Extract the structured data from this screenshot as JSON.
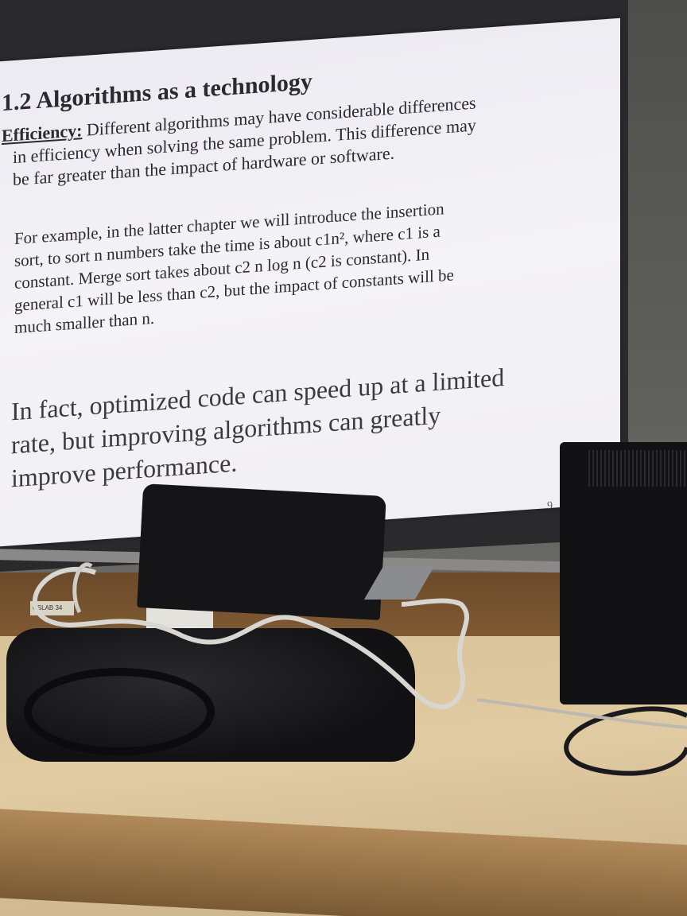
{
  "slide": {
    "title": "1.2 Algorithms as a technology",
    "paragraph1": {
      "label": "Efficiency:",
      "line1": " Different algorithms may have considerable differences",
      "line2": "in efficiency when solving the same problem. This difference may",
      "line3": "be far greater than the impact of hardware or software."
    },
    "paragraph2": {
      "line1": "For example, in the latter chapter we will introduce the insertion",
      "line2": "sort, to sort n numbers take the time is about c1n², where c1 is a",
      "line3": "constant. Merge sort takes about c2 n log n (c2 is constant). In",
      "line4": "general c1 will be less than c2, but the impact of constants will be",
      "line5": "much smaller than n."
    },
    "paragraph3": {
      "line1": "In fact, optimized code can speed up at a limited",
      "line2": "rate, but improving algorithms can greatly",
      "line3": "improve performance."
    },
    "page_number": "9"
  },
  "desk": {
    "sticker_label": "CSLAB 34"
  }
}
